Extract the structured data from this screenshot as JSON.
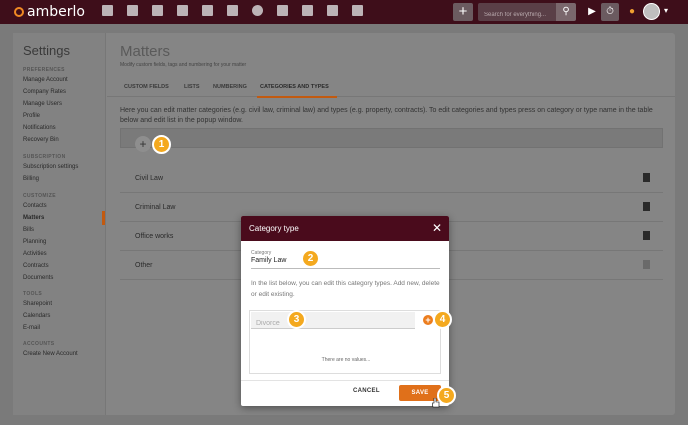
{
  "app": {
    "brand": "amberlo"
  },
  "topbar": {
    "nav_icons": [
      "dashboard-icon",
      "contacts-icon",
      "matters-icon",
      "documents-icon",
      "billing-icon",
      "calendar-icon",
      "history-icon",
      "folder-icon",
      "files-icon",
      "email-icon",
      "reports-icon"
    ],
    "search_placeholder": "Search for everything..."
  },
  "sidebar": {
    "title": "Settings",
    "sections": [
      {
        "label": "PREFERENCES",
        "items": [
          "Manage Account",
          "Company Rates",
          "Manage Users",
          "Profile",
          "Notifications",
          "Recovery Bin"
        ]
      },
      {
        "label": "SUBSCRIPTION",
        "items": [
          "Subscription settings",
          "Billing"
        ]
      },
      {
        "label": "CUSTOMIZE",
        "items": [
          "Contacts",
          "Matters",
          "Bills",
          "Planning",
          "Activities",
          "Contracts",
          "Documents"
        ]
      },
      {
        "label": "TOOLS",
        "items": [
          "Sharepoint",
          "Calendars",
          "E-mail"
        ]
      },
      {
        "label": "ACCOUNTS",
        "items": [
          "Create New Account"
        ]
      }
    ],
    "active": "Matters"
  },
  "main": {
    "title": "Matters",
    "subtitle": "Modify custom fields, tags and numbering for your matter",
    "tabs": [
      "CUSTOM FIELDS",
      "LISTS",
      "NUMBERING",
      "CATEGORIES AND TYPES"
    ],
    "active_tab": "CATEGORIES AND TYPES",
    "description": "Here you can edit matter categories (e.g. civil law, criminal law) and types (e.g. property, contracts). To edit categories and types press on category or type name in the table below and edit list in the popup window.",
    "categories": [
      "Civil Law",
      "Criminal Law",
      "Office works",
      "Other"
    ]
  },
  "modal": {
    "title": "Category type",
    "close": "✕",
    "field_label": "Category",
    "field_value": "Family Law",
    "help_text": "In the list below, you can edit this category types. Add new, delete or edit existing.",
    "list_input_placeholder": "Divorce",
    "empty_text": "There are no values...",
    "cancel_label": "CANCEL",
    "save_label": "SAVE"
  },
  "badges": [
    "1",
    "2",
    "3",
    "4",
    "5"
  ],
  "colors": {
    "topbar": "#3e0e1a",
    "accent": "#e0701a",
    "badge": "#f4a91f",
    "modal_header": "#4a0b1c"
  }
}
